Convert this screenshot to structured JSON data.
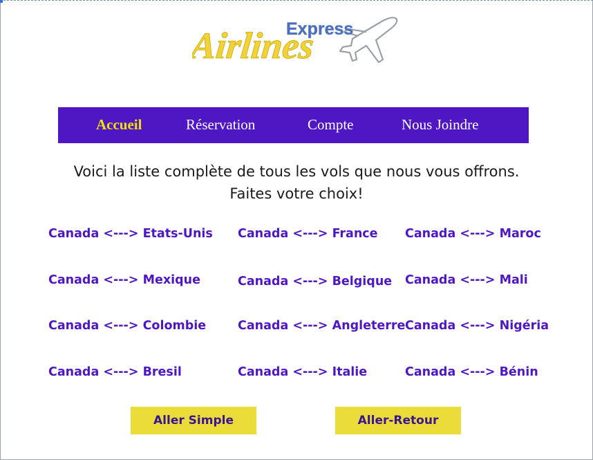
{
  "logo": {
    "top_word": "Express",
    "main_word": "Airlines",
    "colors": {
      "express": "#4a6fb8",
      "airlines": "#f2d23a",
      "plane": "#9aa0a6"
    }
  },
  "nav": {
    "background": "#4f17c4",
    "items": [
      {
        "label": "Accueil",
        "active": true
      },
      {
        "label": "Réservation",
        "active": false
      },
      {
        "label": "Compte",
        "active": false
      },
      {
        "label": "Nous Joindre",
        "active": false
      }
    ]
  },
  "intro": {
    "line1": "Voici la liste complète de tous les vols que nous vous offrons.",
    "line2": "Faites votre choix!"
  },
  "routes": [
    {
      "from": "Canada",
      "arrow": "<--->",
      "to": "Etats-Unis"
    },
    {
      "from": "Canada",
      "arrow": "<--->",
      "to": "France"
    },
    {
      "from": "Canada",
      "arrow": "<--->",
      "to": "Maroc"
    },
    {
      "from": "Canada",
      "arrow": "<--->",
      "to": "Mexique"
    },
    {
      "from": "Canada",
      "arrow": "<--->",
      "to": "Belgique"
    },
    {
      "from": "Canada",
      "arrow": "<--->",
      "to": "Mali"
    },
    {
      "from": "Canada",
      "arrow": "<--->",
      "to": "Colombie"
    },
    {
      "from": "Canada",
      "arrow": "<--->",
      "to": "Angleterre"
    },
    {
      "from": "Canada",
      "arrow": "<--->",
      "to": "Nigéria"
    },
    {
      "from": "Canada",
      "arrow": "<--->",
      "to": "Bresil"
    },
    {
      "from": "Canada",
      "arrow": "<--->",
      "to": "Italie"
    },
    {
      "from": "Canada",
      "arrow": "<--->",
      "to": "Bénin"
    }
  ],
  "buttons": {
    "one_way": "Aller Simple",
    "round_trip": "Aller-Retour"
  },
  "colors": {
    "accent": "#4f17c4",
    "active_nav": "#f1e10a",
    "button_bg": "#ecdc3a",
    "button_text": "#3a1590"
  }
}
